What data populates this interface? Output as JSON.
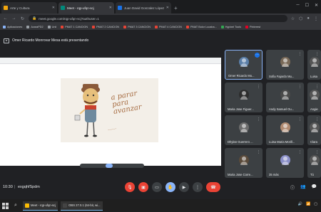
{
  "browser": {
    "tabs": [
      {
        "title": "Arte y Cultura",
        "color": "#f2a60d",
        "active": false
      },
      {
        "title": "Meet - rqp-ufqn-scj",
        "color": "#00897b",
        "active": true
      },
      {
        "title": "Juan David Gonzalez López - 3C",
        "color": "#1a73e8",
        "active": false
      }
    ],
    "url": "meet.google.com/rqp-ufqn-scj?authuser=1",
    "bookmarks": [
      {
        "label": "Aplicaciones",
        "color": "#8ab4f8"
      },
      {
        "label": "AzaraPD2",
        "color": "#9aa0a6"
      },
      {
        "label": "Unil",
        "color": "#9aa0a6"
      },
      {
        "label": "PMAT 1 CANCION",
        "color": "#ea4335"
      },
      {
        "label": "PMAT 2 CANCION",
        "color": "#ea4335"
      },
      {
        "label": "PMAT 3 CANCION",
        "color": "#ea4335"
      },
      {
        "label": "PMAT 4 CANCION",
        "color": "#ea4335"
      },
      {
        "label": "PMAT Bolor Lucaba...",
        "color": "#ea4335"
      },
      {
        "label": "Hypixel Tools",
        "color": "#34a853"
      },
      {
        "label": "Pinterest",
        "color": "#e60023"
      }
    ]
  },
  "meeting": {
    "presenter_banner": "Omer Ricardo Monrovar Mesa está presentando",
    "slide_text": "a parar para avanzar",
    "time": "10:30",
    "code": "exgqhfSpdm",
    "participants": [
      {
        "name": "Omer Ricardo Mo...",
        "selected": true,
        "avatar_color": "#5b7fa8"
      },
      {
        "name": "Sofia Fajardo Mu...",
        "selected": false,
        "avatar_color": "#7a6a58"
      },
      {
        "name": "Luisa",
        "selected": false,
        "avatar_color": "#555"
      },
      {
        "name": "Maria Jose Figuer...",
        "selected": false,
        "avatar_color": "#2d2d2d"
      },
      {
        "name": "Andy Samuel Ou...",
        "selected": false,
        "avatar_color": "#4a4a4a"
      },
      {
        "name": "Angie",
        "selected": false,
        "avatar_color": "#555"
      },
      {
        "name": "Dhylan Guerrero ...",
        "selected": false,
        "avatar_color": "#6b6b6b"
      },
      {
        "name": "Luisa Maria Morill...",
        "selected": false,
        "avatar_color": "#b08a70"
      },
      {
        "name": "Clara",
        "selected": false,
        "avatar_color": "#555"
      },
      {
        "name": "Maria Jose Corre...",
        "selected": false,
        "avatar_color": "#5a4a3a"
      },
      {
        "name": "35 más",
        "selected": false,
        "avatar_color": "#8a8fc8"
      },
      {
        "name": "Tú",
        "selected": false,
        "avatar_color": "#555"
      }
    ]
  },
  "taskbar": {
    "apps": [
      {
        "label": "Meet - rqp-ufqn-scj",
        "color": "#fbbc04"
      },
      {
        "label": "OBS 27.0.1 (64-bit, wi...",
        "color": "#444"
      }
    ]
  }
}
